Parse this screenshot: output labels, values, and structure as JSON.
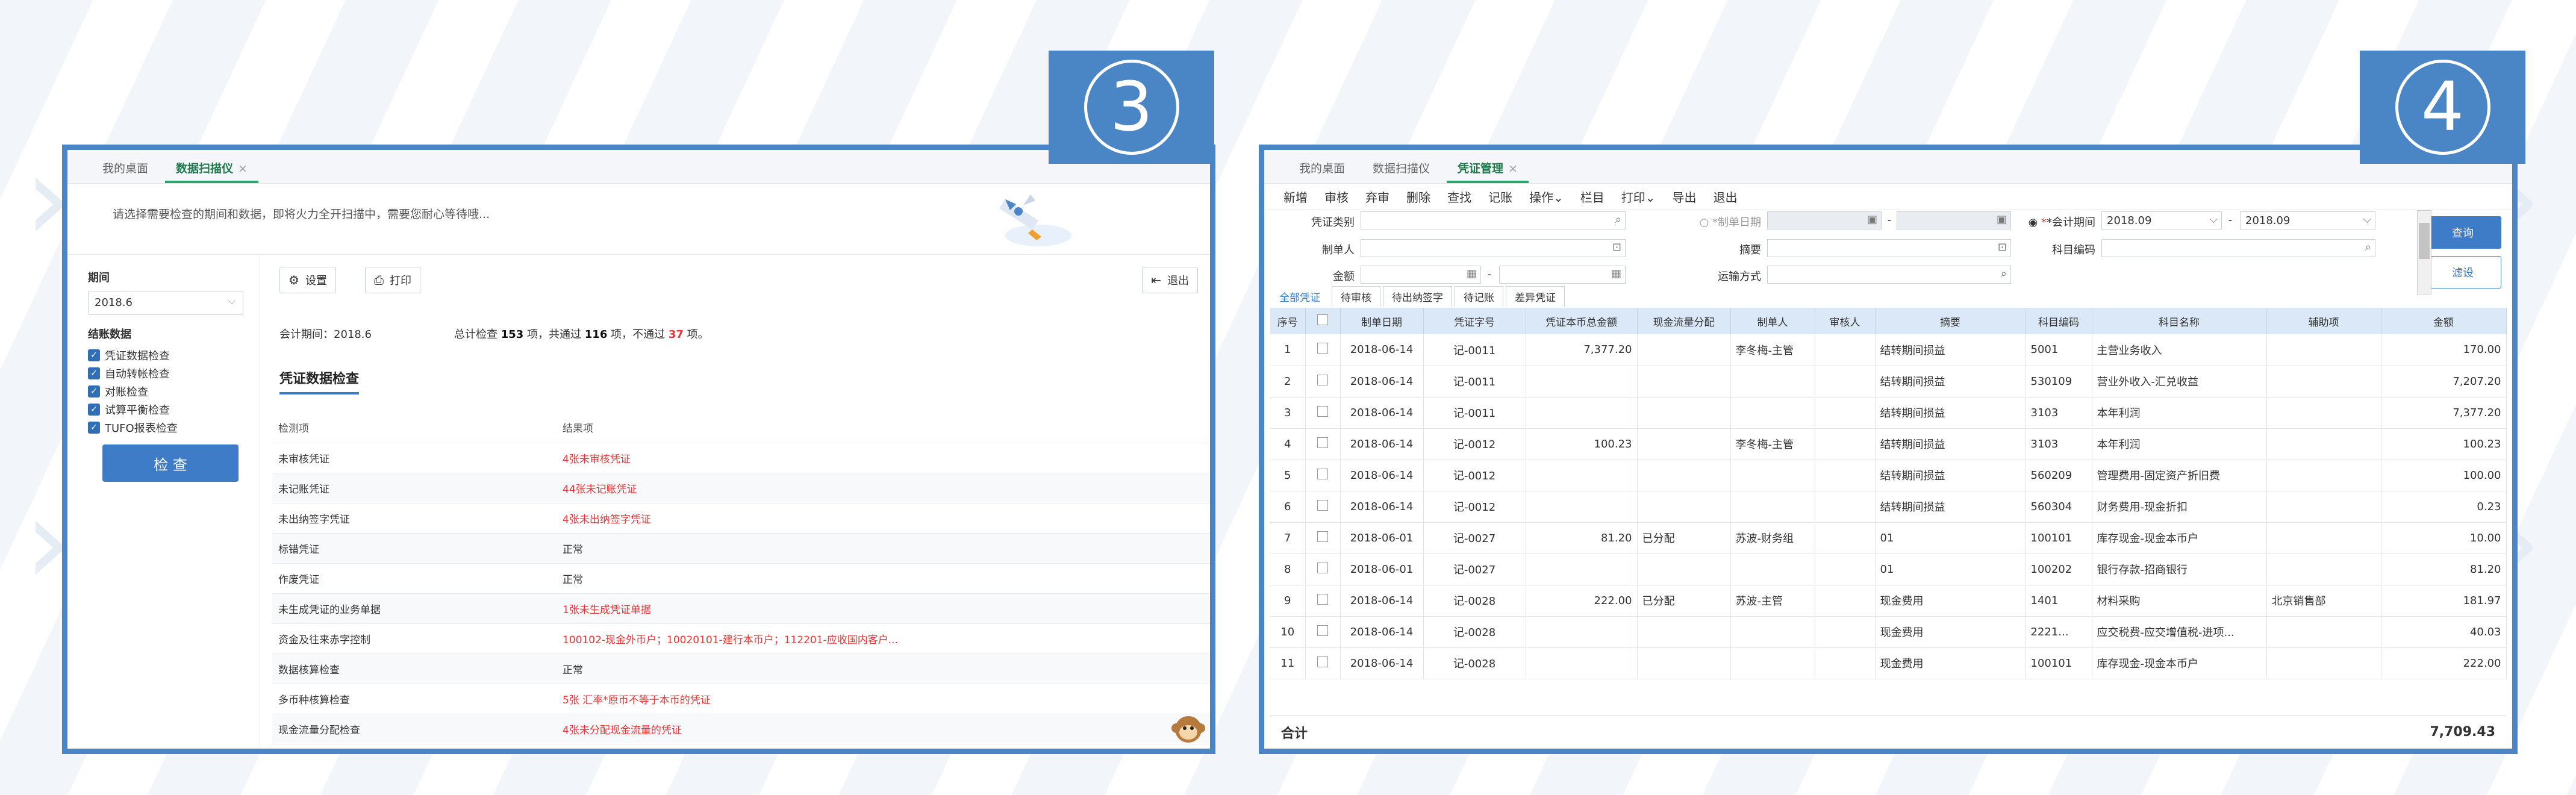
{
  "panel3": {
    "badge": "3",
    "tabs": [
      {
        "label": "我的桌面"
      },
      {
        "label": "数据扫描仪",
        "close": "×"
      }
    ],
    "notice": "请选择需要检查的期间和数据，即将火力全开扫描中，需要您耐心等待哦...",
    "period_label": "期间",
    "period_value": "2018.6",
    "data_label": "结账数据",
    "checks": [
      "凭证数据检查",
      "自动转帐检查",
      "对账检查",
      "试算平衡检查",
      "TUFO报表检查"
    ],
    "check_button": "检 查",
    "settings_button": "设置",
    "print_button": "打印",
    "exit_button": "退出",
    "accounting_period": "会计期间：2018.6",
    "summary_pre": "总计检查",
    "summary_total": "153",
    "summary_mid1": "项，共通过",
    "summary_pass": "116",
    "summary_mid2": "项，不通过",
    "summary_fail": "37",
    "summary_post": "项。",
    "section_title": "凭证数据检查",
    "table_headers": [
      "检测项",
      "结果项"
    ],
    "rows": [
      {
        "item": "未审核凭证",
        "result": "4张未审核凭证",
        "status": "red"
      },
      {
        "item": "未记账凭证",
        "result": "44张未记账凭证",
        "status": "red"
      },
      {
        "item": "未出纳签字凭证",
        "result": "4张未出纳签字凭证",
        "status": "red"
      },
      {
        "item": "标错凭证",
        "result": "正常",
        "status": "ok"
      },
      {
        "item": "作废凭证",
        "result": "正常",
        "status": "ok"
      },
      {
        "item": "未生成凭证的业务单据",
        "result": "1张未生成凭证单据",
        "status": "red"
      },
      {
        "item": "资金及往来赤字控制",
        "result": "100102-现金外币户；10020101-建行本币户；112201-应收国内客户...",
        "status": "red"
      },
      {
        "item": "数据核算检查",
        "result": "正常",
        "status": "ok"
      },
      {
        "item": "多币种核算检查",
        "result": "5张 汇率*原币不等于本币的凭证",
        "status": "red"
      },
      {
        "item": "现金流量分配检查",
        "result": "4张未分配现金流量的凭证",
        "status": "red"
      }
    ]
  },
  "panel4": {
    "badge": "4",
    "tabs": [
      {
        "label": "我的桌面"
      },
      {
        "label": "数据扫描仪"
      },
      {
        "label": "凭证管理",
        "close": "×"
      }
    ],
    "menu": [
      "新增",
      "审核",
      "弃审",
      "删除",
      "查找",
      "记账",
      "操作⌄",
      "栏目",
      "打印⌄",
      "导出",
      "退出"
    ],
    "filter": {
      "voucher_type_label": "凭证类别",
      "maker_label": "制单人",
      "amount_label": "金额",
      "make_date_label": "*制单日期",
      "summary_label": "摘要",
      "transport_label": "运输方式",
      "acct_period_label": "*会计期间",
      "acct_period_from": "2018.09",
      "acct_period_to": "2018.09",
      "subject_code_label": "科目编码",
      "dash": "-",
      "query_button": "查询",
      "filter_button": "滤设"
    },
    "voucher_tabs": [
      "全部凭证",
      "待审核",
      "待出纳签字",
      "待记账",
      "差异凭证"
    ],
    "headers": [
      "序号",
      "",
      "制单日期",
      "凭证字号",
      "凭证本币总金额",
      "现金流量分配",
      "制单人",
      "审核人",
      "摘要",
      "科目编码",
      "科目名称",
      "辅助项",
      "金额"
    ],
    "rows": [
      {
        "no": "1",
        "date": "2018-06-14",
        "vno": "记-0011",
        "total": "7,377.20",
        "cash": "",
        "maker": "李冬梅-主管",
        "auditor": "",
        "summary": "结转期间损益",
        "code": "5001",
        "name": "主营业务收入",
        "aux": "",
        "amt": "170.00"
      },
      {
        "no": "2",
        "date": "2018-06-14",
        "vno": "记-0011",
        "total": "",
        "cash": "",
        "maker": "",
        "auditor": "",
        "summary": "结转期间损益",
        "code": "530109",
        "name": "营业外收入-汇兑收益",
        "aux": "",
        "amt": "7,207.20"
      },
      {
        "no": "3",
        "date": "2018-06-14",
        "vno": "记-0011",
        "total": "",
        "cash": "",
        "maker": "",
        "auditor": "",
        "summary": "结转期间损益",
        "code": "3103",
        "name": "本年利润",
        "aux": "",
        "amt": "7,377.20"
      },
      {
        "no": "4",
        "date": "2018-06-14",
        "vno": "记-0012",
        "total": "100.23",
        "cash": "",
        "maker": "李冬梅-主管",
        "auditor": "",
        "summary": "结转期间损益",
        "code": "3103",
        "name": "本年利润",
        "aux": "",
        "amt": "100.23"
      },
      {
        "no": "5",
        "date": "2018-06-14",
        "vno": "记-0012",
        "total": "",
        "cash": "",
        "maker": "",
        "auditor": "",
        "summary": "结转期间损益",
        "code": "560209",
        "name": "管理费用-固定资产折旧费",
        "aux": "",
        "amt": "100.00"
      },
      {
        "no": "6",
        "date": "2018-06-14",
        "vno": "记-0012",
        "total": "",
        "cash": "",
        "maker": "",
        "auditor": "",
        "summary": "结转期间损益",
        "code": "560304",
        "name": "财务费用-现金折扣",
        "aux": "",
        "amt": "0.23"
      },
      {
        "no": "7",
        "date": "2018-06-01",
        "vno": "记-0027",
        "total": "81.20",
        "cash": "已分配",
        "maker": "苏波-财务组",
        "auditor": "",
        "summary": "01",
        "code": "100101",
        "name": "库存现金-现金本币户",
        "aux": "",
        "amt": "10.00"
      },
      {
        "no": "8",
        "date": "2018-06-01",
        "vno": "记-0027",
        "total": "",
        "cash": "",
        "maker": "",
        "auditor": "",
        "summary": "01",
        "code": "100202",
        "name": "银行存款-招商银行",
        "aux": "",
        "amt": "81.20"
      },
      {
        "no": "9",
        "date": "2018-06-14",
        "vno": "记-0028",
        "total": "222.00",
        "cash": "已分配",
        "maker": "苏波-主管",
        "auditor": "",
        "summary": "现金费用",
        "code": "1401",
        "name": "材料采购",
        "aux": "北京销售部",
        "amt": "181.97"
      },
      {
        "no": "10",
        "date": "2018-06-14",
        "vno": "记-0028",
        "total": "",
        "cash": "",
        "maker": "",
        "auditor": "",
        "summary": "现金费用",
        "code": "2221...",
        "name": "应交税费-应交增值税-进项...",
        "aux": "",
        "amt": "40.03"
      },
      {
        "no": "11",
        "date": "2018-06-14",
        "vno": "记-0028",
        "total": "",
        "cash": "",
        "maker": "",
        "auditor": "",
        "summary": "现金费用",
        "code": "100101",
        "name": "库存现金-现金本币户",
        "aux": "",
        "amt": "222.00"
      }
    ],
    "total_label": "合计",
    "total_value": "7,709.43"
  }
}
